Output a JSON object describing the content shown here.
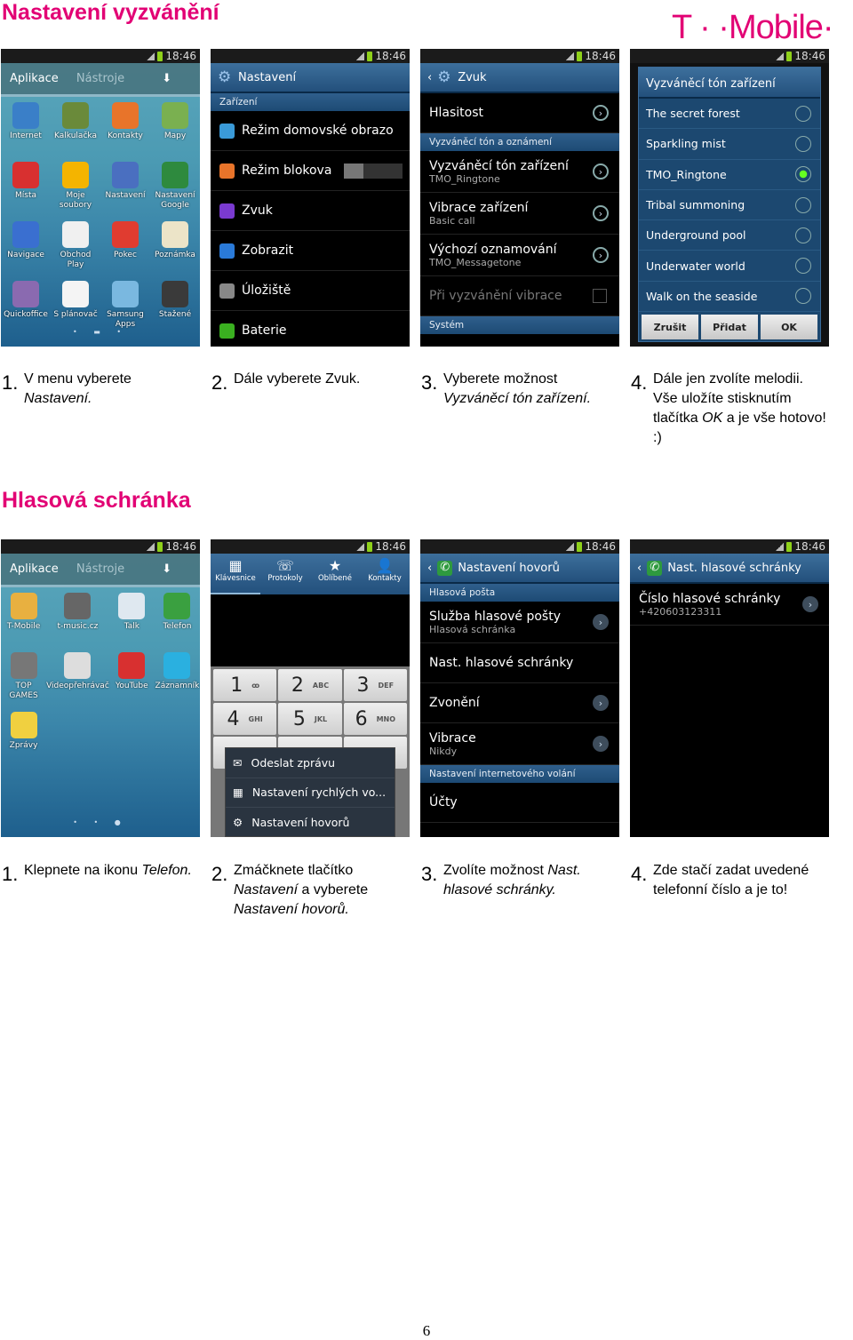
{
  "section1": {
    "title": "Nastavení vyzvánění"
  },
  "section2": {
    "title": "Hlasová schránka"
  },
  "logo": "T · ·Mobile·",
  "page_number": "6",
  "status_time": "18:46",
  "accent": "#e20074",
  "screens": [
    {
      "type": "drawer",
      "tabs": [
        "Aplikace",
        "Nástroje"
      ],
      "apps": [
        [
          "Internet",
          "#3a7fc8"
        ],
        [
          "Kalkulačka",
          "#6a8a3a"
        ],
        [
          "Kontakty",
          "#e8742a"
        ],
        [
          "Mapy",
          "#7ab050"
        ],
        [
          "Místa",
          "#d83030"
        ],
        [
          "Moje soubory",
          "#f4b400"
        ],
        [
          "Nastavení",
          "#4a6fc0"
        ],
        [
          "Nastavení Google",
          "#2e8a3e"
        ],
        [
          "Navigace",
          "#3a6fd0"
        ],
        [
          "Obchod Play",
          "#f0f0f0"
        ],
        [
          "Pokec",
          "#e03c30"
        ],
        [
          "Poznámka",
          "#ece4c8"
        ],
        [
          "Quickoffice",
          "#8a6ab0"
        ],
        [
          "S plánovač",
          "#f4f4f4"
        ],
        [
          "Samsung Apps",
          "#7ab8e0"
        ],
        [
          "Stažené",
          "#3a3a3a"
        ]
      ],
      "dots": "• ▬ •"
    },
    {
      "type": "list",
      "header": "Nastavení",
      "hicon": "gear",
      "rows": [
        {
          "sec": "Zařízení"
        },
        {
          "t": "Režim domovské obrazo",
          "ic": "#3a9ad8"
        },
        {
          "t": "Režim blokova",
          "ic": "#e8742a",
          "toggle": true
        },
        {
          "t": "Zvuk",
          "ic": "#7a3ad0"
        },
        {
          "t": "Zobrazit",
          "ic": "#2a7ad8"
        },
        {
          "t": "Úložiště",
          "ic": "#888"
        },
        {
          "t": "Baterie",
          "ic": "#3ab020"
        }
      ]
    },
    {
      "type": "list",
      "header": "Zvuk",
      "hicon": "gear",
      "back": true,
      "rows": [
        {
          "t": "Hlasitost",
          "ch": true
        },
        {
          "sec": "Vyzváněcí tón a oznámení"
        },
        {
          "t": "Vyzváněcí tón zařízení",
          "s": "TMO_Ringtone",
          "ch": true
        },
        {
          "t": "Vibrace zařízení",
          "s": "Basic call",
          "ch": true
        },
        {
          "t": "Výchozí oznamování",
          "s": "TMO_Messagetone",
          "ch": true
        },
        {
          "t": "Při vyzvánění vibrace",
          "dim": true,
          "cb": true
        },
        {
          "sec": "Systém"
        }
      ]
    },
    {
      "type": "dialog",
      "title": "Vyzváněcí tón zařízení",
      "options": [
        "The secret forest",
        "Sparkling mist",
        "TMO_Ringtone",
        "Tribal summoning",
        "Underground pool",
        "Underwater world",
        "Walk on the seaside"
      ],
      "selected": "TMO_Ringtone",
      "buttons": [
        "Zrušit",
        "Přidat",
        "OK"
      ]
    },
    {
      "type": "drawer",
      "tabs": [
        "Aplikace",
        "Nástroje"
      ],
      "apps": [
        [
          "T-Mobile",
          "#e8b040"
        ],
        [
          "t-music.cz",
          "#666"
        ],
        [
          "Talk",
          "#dfe8f0"
        ],
        [
          "Telefon",
          "#3aa040"
        ],
        [
          "TOP GAMES",
          "#777"
        ],
        [
          "Videopřehrávač",
          "#ddd"
        ],
        [
          "YouTube",
          "#d83030"
        ],
        [
          "Záznamník",
          "#2ab0e0"
        ],
        [
          "Zprávy",
          "#f0d040"
        ]
      ],
      "dots": "• • ●"
    },
    {
      "type": "dialer",
      "tabs": [
        "Klávesnice",
        "Protokoly",
        "Oblíbené",
        "Kontakty"
      ],
      "keys": [
        [
          "1",
          "ꝏ"
        ],
        [
          "2",
          "ABC"
        ],
        [
          "3",
          "DEF"
        ],
        [
          "4",
          "GHI"
        ],
        [
          "5",
          "JKL"
        ],
        [
          "6",
          "MNO"
        ]
      ],
      "menu": [
        "Odeslat zprávu",
        "Nastavení rychlých vo...",
        "Nastavení hovorů"
      ]
    },
    {
      "type": "list",
      "header": "Nastavení hovorů",
      "hicon": "phone",
      "back": true,
      "rows": [
        {
          "sec": "Hlasová pošta"
        },
        {
          "t": "Služba hlasové pošty",
          "s": "Hlasová schránka",
          "chf": true
        },
        {
          "t": "Nast. hlasové schránky"
        },
        {
          "t": "Zvonění",
          "chf": true
        },
        {
          "t": "Vibrace",
          "s": "Nikdy",
          "chf": true
        },
        {
          "sec": "Nastavení internetového volání"
        },
        {
          "t": "Účty"
        }
      ]
    },
    {
      "type": "list",
      "header": "Nast. hlasové schránky",
      "hicon": "phone",
      "back": true,
      "rows": [
        {
          "t": "Číslo hlasové schránky",
          "s": "+420603123311",
          "chf": true
        }
      ]
    }
  ],
  "captions": [
    {
      "n": "1.",
      "parts": [
        [
          "V menu vyberete ",
          0
        ],
        [
          "Nastavení.",
          1
        ]
      ]
    },
    {
      "n": "2.",
      "parts": [
        [
          "Dále vyberete Zvuk.",
          0
        ]
      ]
    },
    {
      "n": "3.",
      "parts": [
        [
          "Vyberete možnost ",
          0
        ],
        [
          "Vyzváněcí tón zařízení.",
          1
        ]
      ]
    },
    {
      "n": "4.",
      "parts": [
        [
          "Dále jen zvolíte melodii. Vše uložíte stisknutím tlačítka ",
          0
        ],
        [
          "OK",
          1
        ],
        [
          " a je vše hotovo! :)",
          0
        ]
      ]
    },
    {
      "n": "1.",
      "parts": [
        [
          "Klepnete na ikonu ",
          0
        ],
        [
          "Telefon.",
          1
        ]
      ]
    },
    {
      "n": "2.",
      "parts": [
        [
          "Zmáčknete tlačítko ",
          0
        ],
        [
          "Nastavení",
          1
        ],
        [
          " a vyberete ",
          0
        ],
        [
          "Nastavení hovorů.",
          1
        ]
      ]
    },
    {
      "n": "3.",
      "parts": [
        [
          "Zvolíte možnost ",
          0
        ],
        [
          "Nast. hlasové schránky.",
          1
        ]
      ]
    },
    {
      "n": "4.",
      "parts": [
        [
          "Zde stačí zadat uvedené telefonní číslo a je to!",
          0
        ]
      ]
    }
  ]
}
